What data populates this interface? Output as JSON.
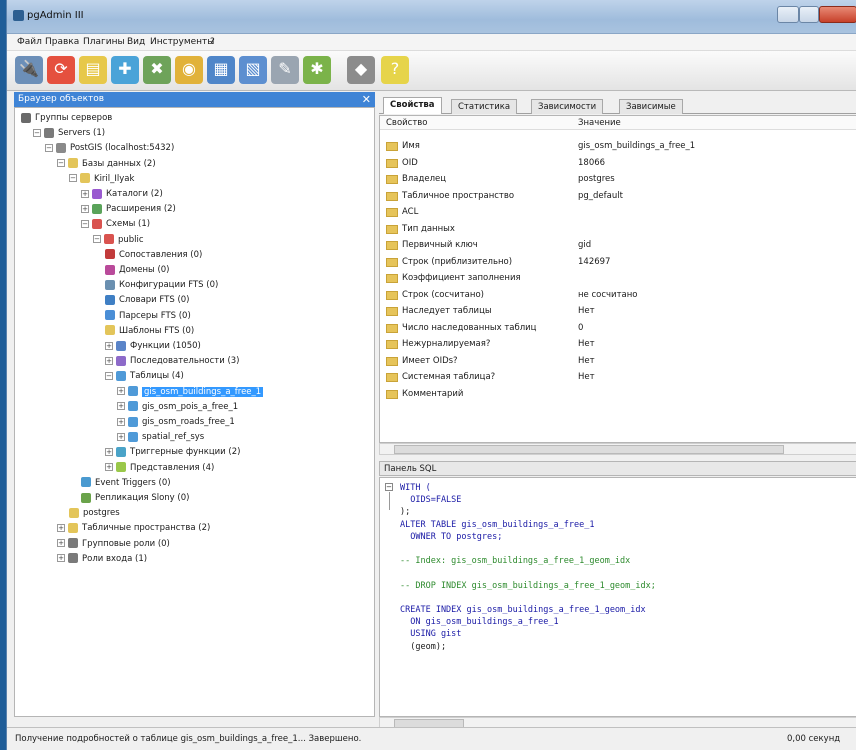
{
  "app": {
    "title": "pgAdmin III"
  },
  "menu": [
    "Файл",
    "Правка",
    "Плагины",
    "Вид",
    "Инструменты",
    "?"
  ],
  "toolbar": [
    {
      "name": "connect-icon",
      "glyph": "🔌",
      "color": "#6c8fb8"
    },
    {
      "name": "refresh-icon",
      "glyph": "⟳",
      "color": "#e5503e"
    },
    {
      "name": "properties-icon",
      "glyph": "▤",
      "color": "#e7c84a"
    },
    {
      "name": "create-object-icon",
      "glyph": "✚",
      "color": "#4aa3d8"
    },
    {
      "name": "drop-object-icon",
      "glyph": "✖",
      "color": "#6ea35a"
    },
    {
      "name": "sql-query-icon",
      "glyph": "◉",
      "color": "#e1b23a"
    },
    {
      "name": "view-data-icon",
      "glyph": "▦",
      "color": "#4f86c9"
    },
    {
      "name": "filtered-data-icon",
      "glyph": "▧",
      "color": "#5d8fd0"
    },
    {
      "name": "maintenance-icon",
      "glyph": "✎",
      "color": "#9aa5b1"
    },
    {
      "name": "plugins-icon",
      "glyph": "✱",
      "color": "#7bb34a"
    },
    {
      "name": "guru-hint-icon",
      "glyph": "◆",
      "color": "#8c8c8c"
    },
    {
      "name": "help-icon",
      "glyph": "?",
      "color": "#e6d44a"
    }
  ],
  "browser": {
    "title": "Браузер объектов",
    "close": "✕"
  },
  "tree": [
    {
      "label": "Группы серверов",
      "level": 0,
      "toggle": "",
      "icon": "#6a6a6a"
    },
    {
      "label": "Servers (1)",
      "level": 1,
      "toggle": "−",
      "icon": "#7a7a7a"
    },
    {
      "label": "PostGIS (localhost:5432)",
      "level": 2,
      "toggle": "−",
      "icon": "#8a8a8a"
    },
    {
      "label": "Базы данных (2)",
      "level": 3,
      "toggle": "−",
      "icon": "#e3c55a"
    },
    {
      "label": "Kiril_Ilyak",
      "level": 4,
      "toggle": "−",
      "icon": "#e3c55a"
    },
    {
      "label": "Каталоги (2)",
      "level": 5,
      "toggle": "+",
      "icon": "#9a5ad0"
    },
    {
      "label": "Расширения (2)",
      "level": 5,
      "toggle": "+",
      "icon": "#5aa35a"
    },
    {
      "label": "Схемы (1)",
      "level": 5,
      "toggle": "−",
      "icon": "#d9534f"
    },
    {
      "label": "public",
      "level": 6,
      "toggle": "−",
      "icon": "#d9534f"
    },
    {
      "label": "Сопоставления (0)",
      "level": 7,
      "toggle": "",
      "icon": "#c23b3b"
    },
    {
      "label": "Домены (0)",
      "level": 7,
      "toggle": "",
      "icon": "#b94a9a"
    },
    {
      "label": "Конфигурации FTS (0)",
      "level": 7,
      "toggle": "",
      "icon": "#6a8fb0"
    },
    {
      "label": "Словари FTS (0)",
      "level": 7,
      "toggle": "",
      "icon": "#3f7fc4"
    },
    {
      "label": "Парсеры FTS (0)",
      "level": 7,
      "toggle": "",
      "icon": "#4a8ed6"
    },
    {
      "label": "Шаблоны FTS (0)",
      "level": 7,
      "toggle": "",
      "icon": "#e3c55a"
    },
    {
      "label": "Функции (1050)",
      "level": 7,
      "toggle": "+",
      "icon": "#5a84c8"
    },
    {
      "label": "Последовательности (3)",
      "level": 7,
      "toggle": "+",
      "icon": "#8d6ac9"
    },
    {
      "label": "Таблицы (4)",
      "level": 7,
      "toggle": "−",
      "icon": "#4f9ad8"
    },
    {
      "label": "gis_osm_buildings_a_free_1",
      "level": 8,
      "toggle": "+",
      "icon": "#4f9ad8",
      "selected": true
    },
    {
      "label": "gis_osm_pois_a_free_1",
      "level": 8,
      "toggle": "+",
      "icon": "#4f9ad8"
    },
    {
      "label": "gis_osm_roads_free_1",
      "level": 8,
      "toggle": "+",
      "icon": "#4f9ad8"
    },
    {
      "label": "spatial_ref_sys",
      "level": 8,
      "toggle": "+",
      "icon": "#4f9ad8"
    },
    {
      "label": "Триггерные функции (2)",
      "level": 7,
      "toggle": "+",
      "icon": "#4aa3c8"
    },
    {
      "label": "Представления (4)",
      "level": 7,
      "toggle": "+",
      "icon": "#9ac84a"
    },
    {
      "label": "Event Triggers (0)",
      "level": 5,
      "toggle": "",
      "icon": "#4a9ad0"
    },
    {
      "label": "Репликация Slony (0)",
      "level": 5,
      "toggle": "",
      "icon": "#6aa34a"
    },
    {
      "label": "postgres",
      "level": 4,
      "toggle": "",
      "icon": "#e3c55a"
    },
    {
      "label": "Табличные пространства (2)",
      "level": 3,
      "toggle": "+",
      "icon": "#e3c55a"
    },
    {
      "label": "Групповые роли (0)",
      "level": 3,
      "toggle": "+",
      "icon": "#7a7a7a"
    },
    {
      "label": "Роли входа (1)",
      "level": 3,
      "toggle": "+",
      "icon": "#7a7a7a"
    }
  ],
  "tabs": [
    "Свойства",
    "Статистика",
    "Зависимости",
    "Зависимые"
  ],
  "props": {
    "col_key": "Свойство",
    "col_val": "Значение",
    "rows": [
      {
        "k": "Имя",
        "v": "gis_osm_buildings_a_free_1"
      },
      {
        "k": "OID",
        "v": "18066"
      },
      {
        "k": "Владелец",
        "v": "postgres"
      },
      {
        "k": "Табличное пространство",
        "v": "pg_default"
      },
      {
        "k": "ACL",
        "v": ""
      },
      {
        "k": "Тип данных",
        "v": ""
      },
      {
        "k": "Первичный ключ",
        "v": "gid"
      },
      {
        "k": "Строк (приблизительно)",
        "v": "142697"
      },
      {
        "k": "Коэффициент заполнения",
        "v": ""
      },
      {
        "k": "Строк (сосчитано)",
        "v": "не сосчитано"
      },
      {
        "k": "Наследует таблицы",
        "v": "Нет"
      },
      {
        "k": "Число наследованных таблиц",
        "v": "0"
      },
      {
        "k": "Нежурналируемая?",
        "v": "Нет"
      },
      {
        "k": "Имеет OIDs?",
        "v": "Нет"
      },
      {
        "k": "Системная таблица?",
        "v": "Нет"
      },
      {
        "k": "Комментарий",
        "v": ""
      }
    ]
  },
  "sql": {
    "title": "Панель SQL",
    "lines": [
      {
        "t": "WITH (",
        "c": "kw"
      },
      {
        "t": "  OIDS=FALSE",
        "c": "kw"
      },
      {
        "t": ");",
        "c": ""
      },
      {
        "t": "ALTER TABLE gis_osm_buildings_a_free_1",
        "c": "kw"
      },
      {
        "t": "  OWNER TO postgres;",
        "c": "kw"
      },
      {
        "t": "",
        "c": ""
      },
      {
        "t": "-- Index: gis_osm_buildings_a_free_1_geom_idx",
        "c": "cm"
      },
      {
        "t": "",
        "c": ""
      },
      {
        "t": "-- DROP INDEX gis_osm_buildings_a_free_1_geom_idx;",
        "c": "cm"
      },
      {
        "t": "",
        "c": ""
      },
      {
        "t": "CREATE INDEX gis_osm_buildings_a_free_1_geom_idx",
        "c": "kw"
      },
      {
        "t": "  ON gis_osm_buildings_a_free_1",
        "c": "kw"
      },
      {
        "t": "  USING gist",
        "c": "kw"
      },
      {
        "t": "  (geom);",
        "c": ""
      }
    ]
  },
  "status": {
    "message": "Получение подробностей о таблице gis_osm_buildings_a_free_1... Завершено.",
    "time": "0,00 секунд"
  }
}
